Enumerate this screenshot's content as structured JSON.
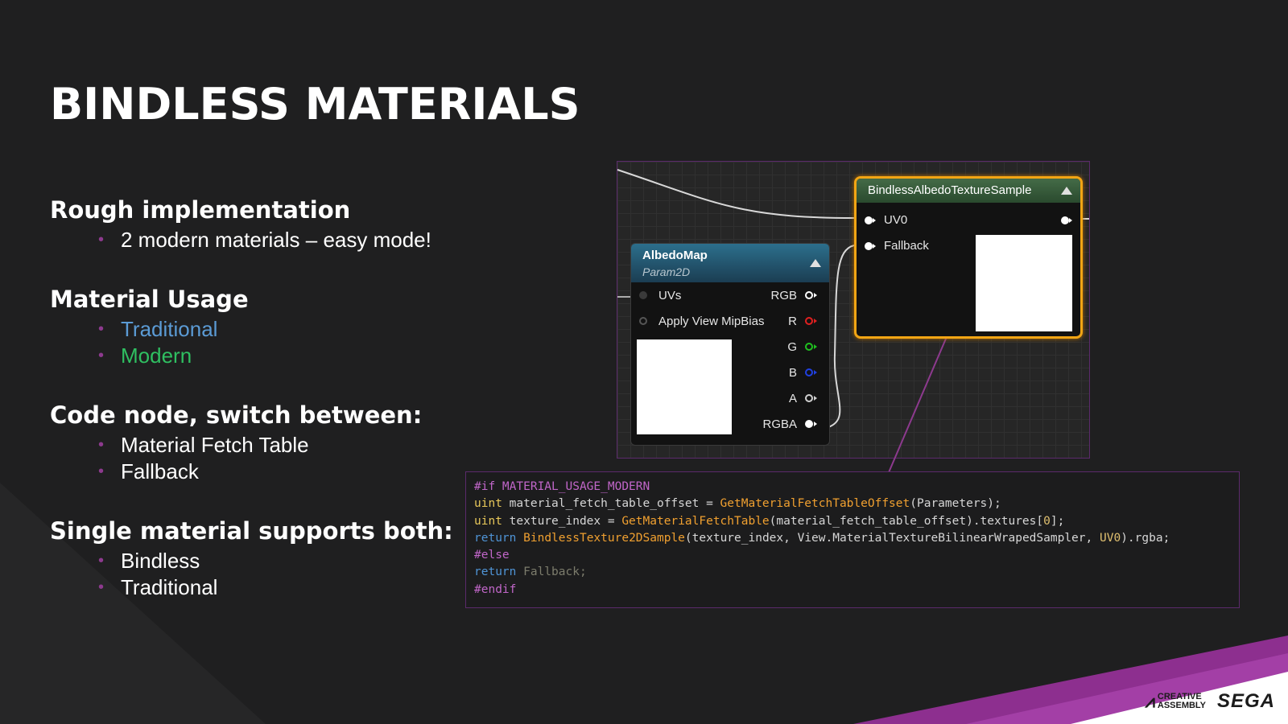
{
  "title": "BINDLESS MATERIALS",
  "sections": [
    {
      "heading": "Rough implementation",
      "bullets": [
        {
          "text": "2 modern materials – easy mode!"
        }
      ]
    },
    {
      "heading": "Material Usage",
      "bullets": [
        {
          "text": "Traditional",
          "color": "#5b9bd5"
        },
        {
          "text": "Modern",
          "color": "#2fbf61"
        }
      ]
    },
    {
      "heading": "Code node, switch between:",
      "bullets": [
        {
          "text": "Material Fetch Table"
        },
        {
          "text": "Fallback"
        }
      ]
    },
    {
      "heading": "Single material supports both:",
      "bullets": [
        {
          "text": "Bindless"
        },
        {
          "text": "Traditional"
        }
      ]
    }
  ],
  "graph": {
    "albedo_node": {
      "title": "AlbedoMap",
      "subtitle": "Param2D",
      "inputs": [
        "UVs",
        "Apply View MipBias"
      ],
      "outputs": [
        {
          "label": "RGB",
          "color": "#ffffff"
        },
        {
          "label": "R",
          "color": "#e02020"
        },
        {
          "label": "G",
          "color": "#20c020"
        },
        {
          "label": "B",
          "color": "#2040e0"
        },
        {
          "label": "A",
          "color": "#d0d0d0"
        },
        {
          "label": "RGBA",
          "color": "#ffffff"
        }
      ]
    },
    "bindless_node": {
      "title": "BindlessAlbedoTextureSample",
      "inputs": [
        "UV0",
        "Fallback"
      ]
    }
  },
  "code": {
    "lines": [
      [
        {
          "t": "#if MATERIAL_USAGE_MODERN",
          "c": "k-dir"
        }
      ],
      [
        {
          "t": "uint",
          "c": "k-type"
        },
        {
          "t": " material_fetch_table_offset = ",
          "c": "k-plain"
        },
        {
          "t": "GetMaterialFetchTableOffset",
          "c": "k-fn"
        },
        {
          "t": "(Parameters);",
          "c": "k-plain"
        }
      ],
      [
        {
          "t": "uint",
          "c": "k-type"
        },
        {
          "t": " texture_index = ",
          "c": "k-plain"
        },
        {
          "t": "GetMaterialFetchTable",
          "c": "k-fn"
        },
        {
          "t": "(material_fetch_table_offset).textures[",
          "c": "k-plain"
        },
        {
          "t": "0",
          "c": "k-sub"
        },
        {
          "t": "];",
          "c": "k-plain"
        }
      ],
      [
        {
          "t": "return",
          "c": "k-ret"
        },
        {
          "t": " ",
          "c": "k-plain"
        },
        {
          "t": "BindlessTexture2DSample",
          "c": "k-fn"
        },
        {
          "t": "(texture_index, View.MaterialTextureBilinearWrapedSampler, ",
          "c": "k-plain"
        },
        {
          "t": "UV0",
          "c": "k-sub"
        },
        {
          "t": ").rgba;",
          "c": "k-plain"
        }
      ],
      [
        {
          "t": "#else",
          "c": "k-dir"
        }
      ],
      [
        {
          "t": "return",
          "c": "k-ret"
        },
        {
          "t": " Fallback;",
          "c": "k-dim"
        }
      ],
      [
        {
          "t": "#endif",
          "c": "k-dir"
        }
      ]
    ]
  },
  "logos": {
    "creative_assembly_line1": "CREATIVE",
    "creative_assembly_line2": "ASSEMBLY",
    "sega": "SEGA"
  },
  "colors": {
    "accent_purple": "#8d3a8e",
    "node_highlight": "#f2a514",
    "traditional": "#5b9bd5",
    "modern": "#2fbf61"
  }
}
